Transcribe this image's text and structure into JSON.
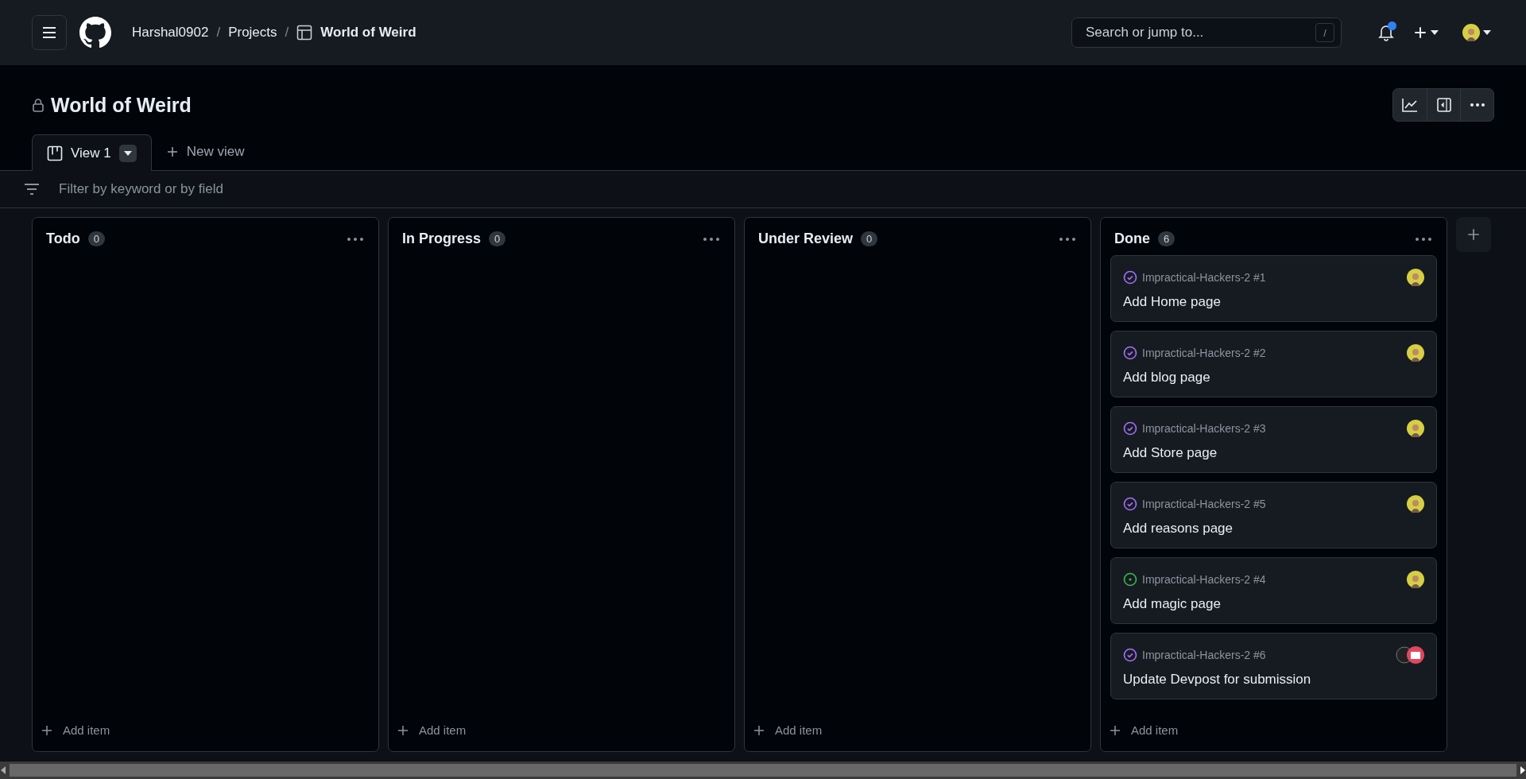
{
  "header": {
    "breadcrumb": [
      {
        "label": "Harshal0902",
        "kind": "link"
      },
      {
        "label": "Projects",
        "kind": "link"
      },
      {
        "label": "World of Weird",
        "kind": "project"
      }
    ],
    "separators": [
      "/",
      "/"
    ],
    "search": {
      "placeholder": "Search or jump to...",
      "shortcut": "/"
    },
    "notifications_unread": true
  },
  "project": {
    "title": "World of Weird",
    "private": true
  },
  "views": [
    {
      "label": "View 1",
      "selected": true
    }
  ],
  "new_view": "New view",
  "filter": {
    "placeholder": "Filter by keyword or by field"
  },
  "columns": [
    {
      "name": "Todo",
      "count": "0",
      "add_label": "Add item"
    },
    {
      "name": "In Progress",
      "count": "0",
      "add_label": "Add item"
    },
    {
      "name": "Under Review",
      "count": "0",
      "add_label": "Add item"
    },
    {
      "name": "Done",
      "count": "6",
      "add_label": "Add item",
      "cards": [
        {
          "ref": "Impractical-Hackers-2 #1",
          "title": "Add Home page",
          "closed": true,
          "avatars": [
            {
              "kind": "person"
            }
          ]
        },
        {
          "ref": "Impractical-Hackers-2 #2",
          "title": "Add blog page",
          "closed": true,
          "avatars": [
            {
              "kind": "person"
            }
          ]
        },
        {
          "ref": "Impractical-Hackers-2 #3",
          "title": "Add Store page",
          "closed": true,
          "avatars": [
            {
              "kind": "person"
            }
          ]
        },
        {
          "ref": "Impractical-Hackers-2 #5",
          "title": "Add reasons page",
          "closed": true,
          "avatars": [
            {
              "kind": "person"
            }
          ]
        },
        {
          "ref": "Impractical-Hackers-2 #4",
          "title": "Add magic page",
          "closed": false,
          "avatars": [
            {
              "kind": "person"
            }
          ]
        },
        {
          "ref": "Impractical-Hackers-2 #6",
          "title": "Update Devpost for submission",
          "closed": true,
          "avatars": [
            {
              "kind": "dark"
            },
            {
              "kind": "badge"
            }
          ]
        }
      ]
    }
  ]
}
